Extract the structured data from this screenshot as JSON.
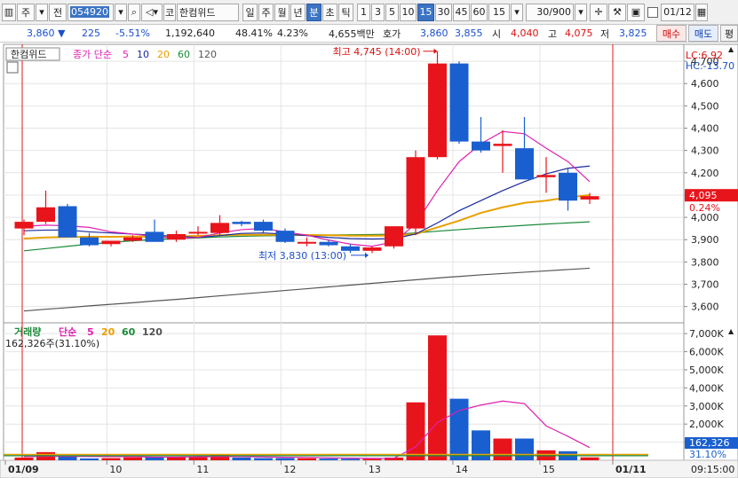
{
  "toolbar": {
    "market": "주",
    "prev_label": "전",
    "code": "054920",
    "company_prefix": "코",
    "company": "한컴위드",
    "periods": [
      "일",
      "주",
      "월",
      "년",
      "분",
      "초",
      "틱"
    ],
    "active_period": "분",
    "intervals": [
      "1",
      "3",
      "5",
      "10",
      "15",
      "30",
      "45",
      "60"
    ],
    "active_interval": "15",
    "interval_select": "15",
    "count": "30/900",
    "date": "01/12"
  },
  "quote": {
    "price": "3,860",
    "change": "225",
    "change_pct": "-5.51%",
    "volume": "1,192,640",
    "vol_ratio": "48.41%",
    "turnover": "4.23%",
    "amount": "4,655백만",
    "ask_label": "호가",
    "ask1": "3,860",
    "ask2": "3,855",
    "open_label": "시",
    "open": "4,040",
    "high_label": "고",
    "high": "4,075",
    "low_label": "저",
    "low": "3,825",
    "buy_label": "매수",
    "sell_label": "매도",
    "eval_label": "평"
  },
  "price_panel": {
    "title": "한컴위드",
    "ma_label": "종가 단순",
    "ma_periods": [
      "5",
      "10",
      "20",
      "60",
      "120"
    ],
    "lc": "LC:6.92",
    "hc": "HC:-13.70",
    "max_annotation": "최고 4,745 (14:00)",
    "min_annotation": "최저 3,830 (13:00)",
    "current_price_tag": "4,095",
    "current_pct_tag": "0.24%"
  },
  "volume_panel": {
    "title": "거래량",
    "ma_label": "단순",
    "ma_periods": [
      "5",
      "20",
      "60",
      "120"
    ],
    "info": "162,326주(31.10%)",
    "current_tag": "162,326",
    "current_pct": "31.10%"
  },
  "time_axis": {
    "labels": [
      "01/09",
      "10",
      "11",
      "12",
      "13",
      "14",
      "15",
      "01/11"
    ],
    "current_time": "09:15:00"
  },
  "colors": {
    "up": "#e8141b",
    "down": "#1a5fd0",
    "ma5": "#e020b0",
    "ma10": "#1a2aa0",
    "ma20": "#e8a000",
    "ma60": "#1a8a3a",
    "ma120": "#555555",
    "grid": "#e4e4e4"
  },
  "chart_data": [
    {
      "type": "candlestick",
      "title": "한컴위드",
      "y_ticks": [
        3600,
        3700,
        3800,
        3900,
        4000,
        4100,
        4200,
        4300,
        4400,
        4500,
        4600,
        4700
      ],
      "ylim": [
        3535,
        4760
      ],
      "candles": [
        {
          "o": 3950,
          "h": 3990,
          "l": 3920,
          "c": 3980
        },
        {
          "o": 3980,
          "h": 4120,
          "l": 3970,
          "c": 4045
        },
        {
          "o": 4050,
          "h": 4060,
          "l": 3920,
          "c": 3910
        },
        {
          "o": 3910,
          "h": 3930,
          "l": 3870,
          "c": 3875
        },
        {
          "o": 3880,
          "h": 3890,
          "l": 3870,
          "c": 3895
        },
        {
          "o": 3895,
          "h": 3920,
          "l": 3890,
          "c": 3910
        },
        {
          "o": 3935,
          "h": 3990,
          "l": 3890,
          "c": 3890
        },
        {
          "o": 3900,
          "h": 3940,
          "l": 3890,
          "c": 3925
        },
        {
          "o": 3930,
          "h": 3960,
          "l": 3920,
          "c": 3935
        },
        {
          "o": 3930,
          "h": 4010,
          "l": 3920,
          "c": 3975
        },
        {
          "o": 3980,
          "h": 3985,
          "l": 3960,
          "c": 3970
        },
        {
          "o": 3980,
          "h": 3990,
          "l": 3930,
          "c": 3940
        },
        {
          "o": 3940,
          "h": 3950,
          "l": 3885,
          "c": 3890
        },
        {
          "o": 3890,
          "h": 3910,
          "l": 3870,
          "c": 3890
        },
        {
          "o": 3890,
          "h": 3900,
          "l": 3870,
          "c": 3875
        },
        {
          "o": 3870,
          "h": 3880,
          "l": 3840,
          "c": 3850
        },
        {
          "o": 3850,
          "h": 3870,
          "l": 3840,
          "c": 3865
        },
        {
          "o": 3870,
          "h": 3960,
          "l": 3860,
          "c": 3960
        },
        {
          "o": 3950,
          "h": 4300,
          "l": 3920,
          "c": 4270
        },
        {
          "o": 4270,
          "h": 4745,
          "l": 4260,
          "c": 4690
        },
        {
          "o": 4690,
          "h": 4700,
          "l": 4330,
          "c": 4340
        },
        {
          "o": 4340,
          "h": 4450,
          "l": 4290,
          "c": 4300
        },
        {
          "o": 4320,
          "h": 4390,
          "l": 4200,
          "c": 4330
        },
        {
          "o": 4310,
          "h": 4450,
          "l": 4170,
          "c": 4170
        },
        {
          "o": 4180,
          "h": 4270,
          "l": 4110,
          "c": 4190
        },
        {
          "o": 4200,
          "h": 4220,
          "l": 4030,
          "c": 4075
        },
        {
          "o": 4080,
          "h": 4110,
          "l": 4060,
          "c": 4095
        }
      ],
      "ma": {
        "ma5": [
          3960,
          3965,
          3962,
          3955,
          3935,
          3925,
          3915,
          3905,
          3910,
          3930,
          3945,
          3950,
          3935,
          3920,
          3898,
          3880,
          3870,
          3890,
          3970,
          4120,
          4250,
          4330,
          4385,
          4375,
          4310,
          4250,
          4160
        ],
        "ma10": [
          3940,
          3943,
          3943,
          3935,
          3930,
          3925,
          3920,
          3915,
          3910,
          3918,
          3928,
          3930,
          3925,
          3918,
          3910,
          3905,
          3903,
          3905,
          3925,
          3975,
          4030,
          4075,
          4120,
          4160,
          4195,
          4220,
          4230
        ],
        "ma20": [
          3905,
          3910,
          3912,
          3913,
          3913,
          3914,
          3914,
          3915,
          3917,
          3920,
          3922,
          3922,
          3922,
          3921,
          3920,
          3918,
          3918,
          3918,
          3925,
          3955,
          3985,
          4020,
          4045,
          4065,
          4075,
          4090,
          4100
        ],
        "ma60": [
          3850,
          3860,
          3870,
          3880,
          3888,
          3895,
          3900,
          3905,
          3908,
          3912,
          3915,
          3917,
          3918,
          3920,
          3921,
          3922,
          3923,
          3925,
          3930,
          3938,
          3945,
          3952,
          3958,
          3964,
          3970,
          3975,
          3980
        ],
        "ma120": [
          3580,
          3588,
          3595,
          3603,
          3610,
          3617,
          3625,
          3632,
          3640,
          3648,
          3656,
          3664,
          3672,
          3680,
          3688,
          3696,
          3704,
          3712,
          3720,
          3728,
          3735,
          3742,
          3748,
          3754,
          3760,
          3766,
          3772
        ]
      }
    },
    {
      "type": "bar",
      "title": "거래량",
      "y_ticks": [
        1000,
        2000,
        3000,
        4000,
        5000,
        6000,
        7000
      ],
      "y_tick_labels": [
        "1,000K",
        "2,000K",
        "3,000K",
        "4,000K",
        "5,000K",
        "6,000K",
        "7,000K"
      ],
      "ylim": [
        0,
        7400
      ],
      "values": [
        150,
        450,
        200,
        100,
        120,
        160,
        200,
        200,
        170,
        300,
        150,
        120,
        120,
        110,
        90,
        80,
        70,
        150,
        3200,
        6900,
        3400,
        1650,
        1200,
        1200,
        550,
        500,
        162
      ],
      "ma5": [
        200,
        220,
        215,
        205,
        200,
        205,
        170,
        175,
        190,
        200,
        200,
        185,
        165,
        155,
        135,
        115,
        105,
        110,
        740,
        2080,
        2750,
        3050,
        3270,
        3130,
        1900,
        1320,
        700
      ]
    }
  ]
}
